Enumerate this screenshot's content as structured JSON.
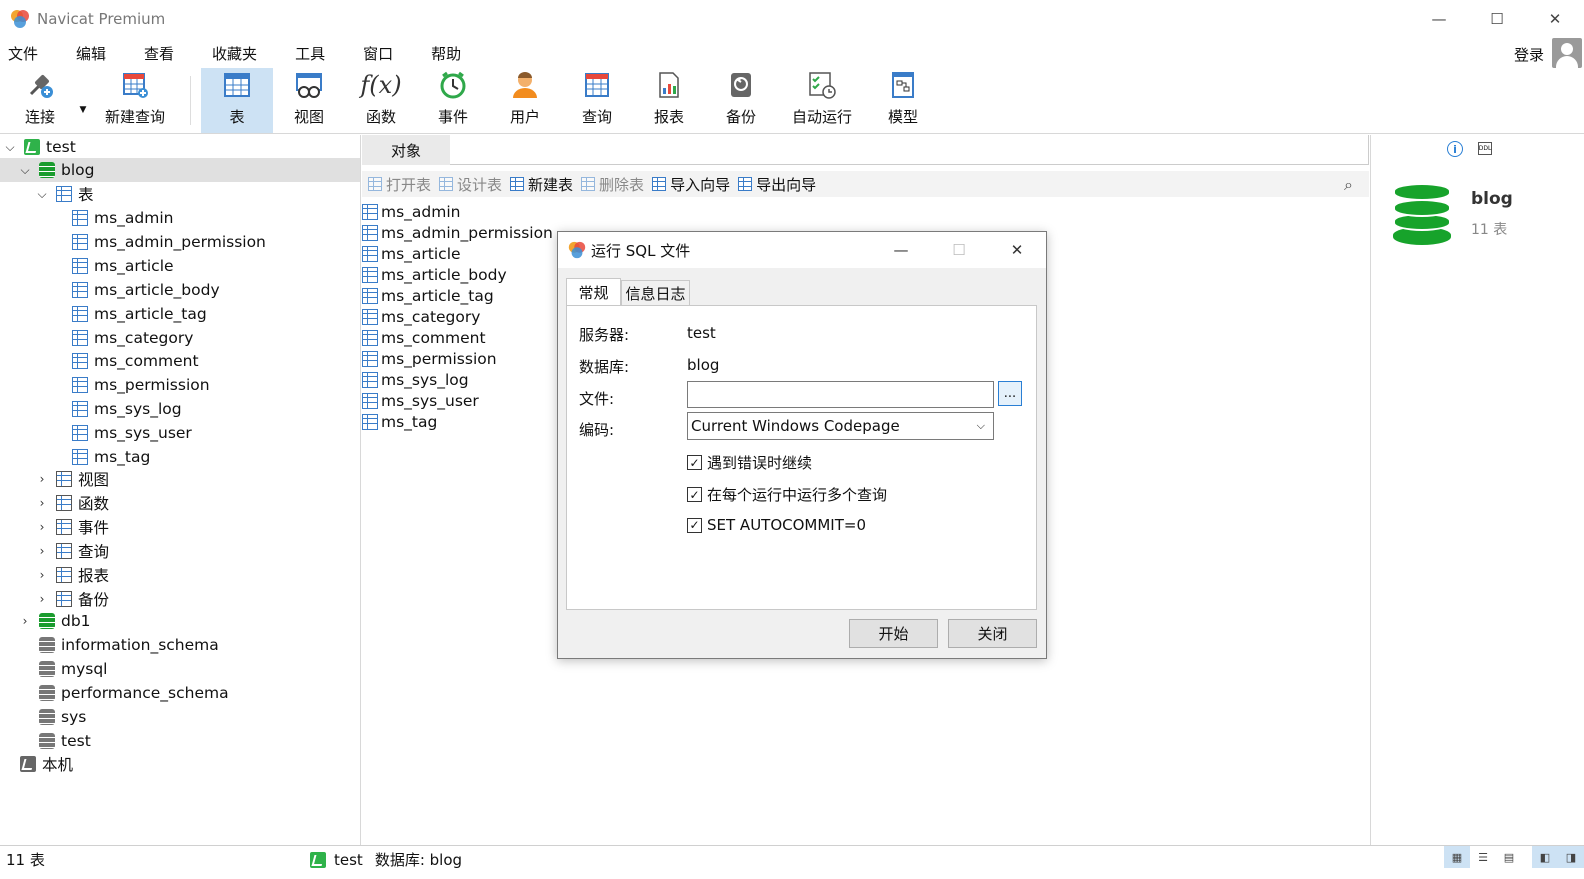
{
  "window": {
    "title": "Navicat Premium",
    "minimize": "—",
    "maximize": "☐",
    "close": "✕"
  },
  "menu": {
    "items": [
      "文件",
      "编辑",
      "查看",
      "收藏夹",
      "工具",
      "窗口",
      "帮助"
    ],
    "login": "登录"
  },
  "toolbar": {
    "items": [
      "连接",
      "新建查询",
      "表",
      "视图",
      "函数",
      "事件",
      "用户",
      "查询",
      "报表",
      "备份",
      "自动运行",
      "模型"
    ],
    "active": "表"
  },
  "tree": {
    "connection": "test",
    "database": "blog",
    "tables_folder": "表",
    "tables": [
      "ms_admin",
      "ms_admin_permission",
      "ms_article",
      "ms_article_body",
      "ms_article_tag",
      "ms_category",
      "ms_comment",
      "ms_permission",
      "ms_sys_log",
      "ms_sys_user",
      "ms_tag"
    ],
    "folders": [
      "视图",
      "函数",
      "事件",
      "查询",
      "报表",
      "备份"
    ],
    "other_dbs": [
      "db1",
      "information_schema",
      "mysql",
      "performance_schema",
      "sys",
      "test"
    ],
    "local": "本机"
  },
  "objects": {
    "tab": "对象",
    "tools": [
      {
        "label": "打开表",
        "enabled": false
      },
      {
        "label": "设计表",
        "enabled": false
      },
      {
        "label": "新建表",
        "enabled": true
      },
      {
        "label": "删除表",
        "enabled": false
      },
      {
        "label": "导入向导",
        "enabled": true
      },
      {
        "label": "导出向导",
        "enabled": true
      }
    ],
    "list": [
      "ms_admin",
      "ms_admin_permission",
      "ms_article",
      "ms_article_body",
      "ms_article_tag",
      "ms_category",
      "ms_comment",
      "ms_permission",
      "ms_sys_log",
      "ms_sys_user",
      "ms_tag"
    ]
  },
  "info_panel": {
    "name": "blog",
    "count": "11 表"
  },
  "status": {
    "count": "11 表",
    "connection": "test",
    "database": "数据库: blog"
  },
  "dialog": {
    "title": "运行 SQL 文件",
    "tabs": [
      "常规",
      "信息日志"
    ],
    "server_label": "服务器:",
    "server_value": "test",
    "db_label": "数据库:",
    "db_value": "blog",
    "file_label": "文件:",
    "file_value": "",
    "browse": "...",
    "encoding_label": "编码:",
    "encoding_value": "Current Windows Codepage",
    "checks": [
      {
        "label": "遇到错误时继续",
        "checked": true
      },
      {
        "label": "在每个运行中运行多个查询",
        "checked": true
      },
      {
        "label": "SET AUTOCOMMIT=0",
        "checked": true
      }
    ],
    "start": "开始",
    "close": "关闭"
  },
  "colors": {
    "accent": "#cde2f4",
    "db_green": "#17a32b",
    "table_blue": "#3a7cc8"
  }
}
